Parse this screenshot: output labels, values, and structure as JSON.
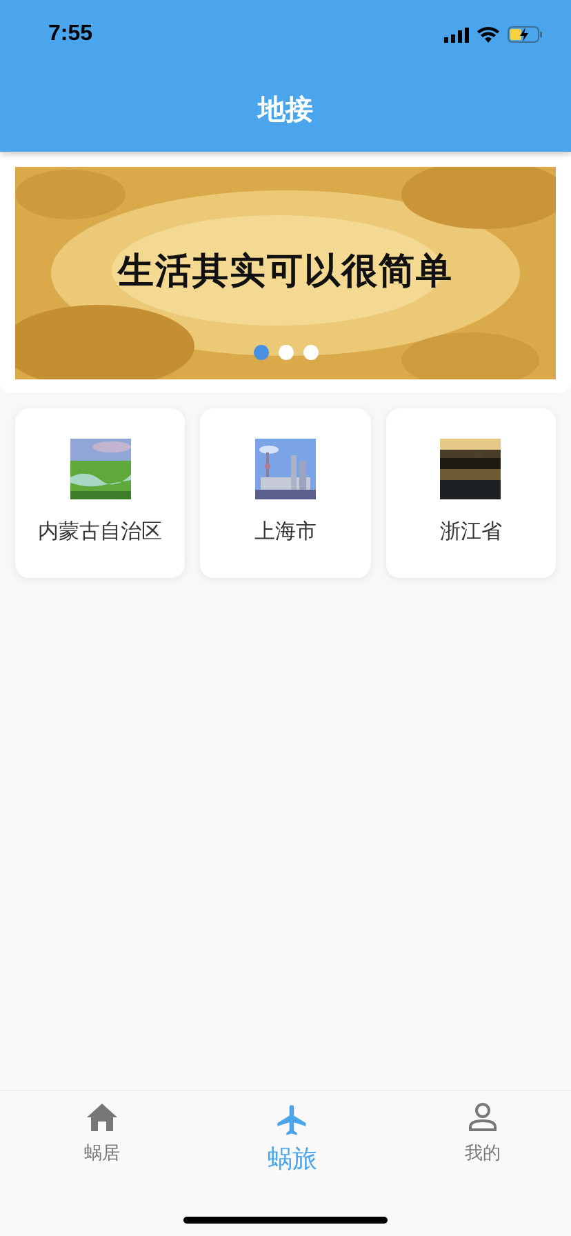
{
  "status_bar": {
    "time": "7:55"
  },
  "header": {
    "title": "地接"
  },
  "banner": {
    "caption": "生活其实可以很简单",
    "dots": [
      {
        "selected": true
      },
      {
        "selected": false
      },
      {
        "selected": false
      }
    ]
  },
  "regions": [
    {
      "name": "内蒙古自治区",
      "kind": "grassland"
    },
    {
      "name": "上海市",
      "kind": "skyline"
    },
    {
      "name": "浙江省",
      "kind": "lake"
    }
  ],
  "tabs": [
    {
      "label": "蜗居",
      "kind": "home",
      "selected": false
    },
    {
      "label": "蜗旅",
      "kind": "plane",
      "selected": true
    },
    {
      "label": "我的",
      "kind": "person",
      "selected": false
    }
  ]
}
